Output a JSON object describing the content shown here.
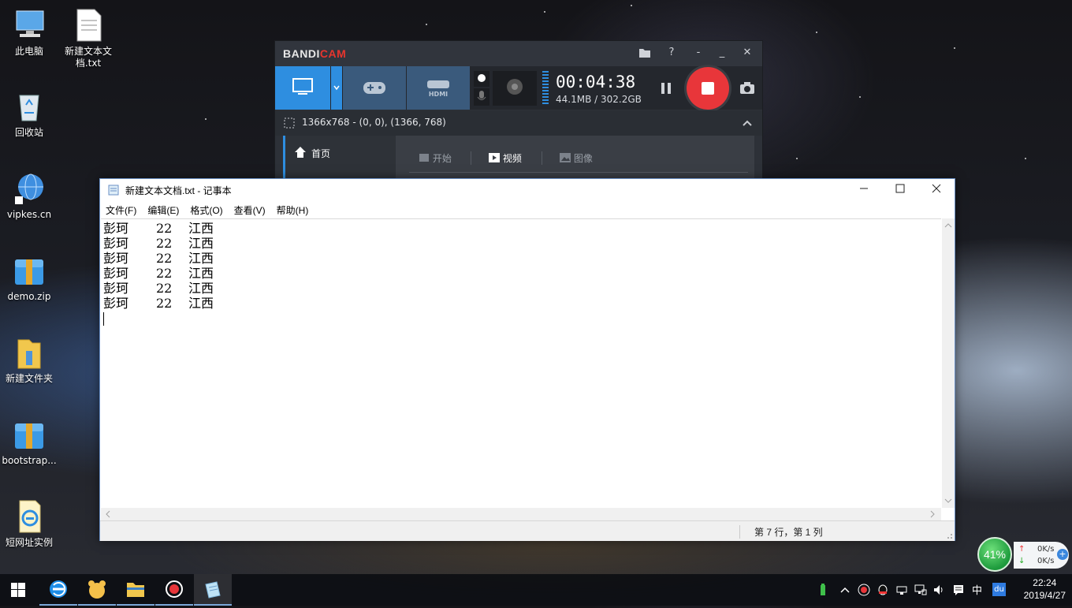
{
  "desktop": {
    "icons": [
      {
        "label": "此电脑"
      },
      {
        "label": "新建文本文档.txt"
      },
      {
        "label": "回收站"
      },
      {
        "label": "vipkes.cn"
      },
      {
        "label": "demo.zip"
      },
      {
        "label": "新建文件夹"
      },
      {
        "label": "bootstrap..."
      },
      {
        "label": "短网址实例"
      }
    ]
  },
  "bandicam": {
    "logo_left": "BANDI",
    "logo_right": "CAM",
    "help": "?",
    "timer": "00:04:38",
    "size": "44.1MB / 302.2GB",
    "region": "1366x768 - (0, 0), (1366, 768)",
    "home": "首页",
    "tabs": {
      "start": "开始",
      "video": "视频",
      "image": "图像"
    },
    "accent": "#2e8ee0",
    "record_color": "#e8363a"
  },
  "notepad": {
    "title": "新建文本文档.txt - 记事本",
    "menu": [
      "文件(F)",
      "编辑(E)",
      "格式(O)",
      "查看(V)",
      "帮助(H)"
    ],
    "rows": [
      {
        "name": "彭珂",
        "age": "22",
        "place": "江西"
      },
      {
        "name": "彭珂",
        "age": "22",
        "place": "江西"
      },
      {
        "name": "彭珂",
        "age": "22",
        "place": "江西"
      },
      {
        "name": "彭珂",
        "age": "22",
        "place": "江西"
      },
      {
        "name": "彭珂",
        "age": "22",
        "place": "江西"
      },
      {
        "name": "彭珂",
        "age": "22",
        "place": "江西"
      }
    ],
    "status": "第 7 行，第 1 列"
  },
  "widget": {
    "percent": "41%",
    "up": "0K/s",
    "down": "0K/s"
  },
  "tray": {
    "ime": "中",
    "du": "du"
  },
  "clock": {
    "time": "22:24",
    "date": "2019/4/27"
  }
}
